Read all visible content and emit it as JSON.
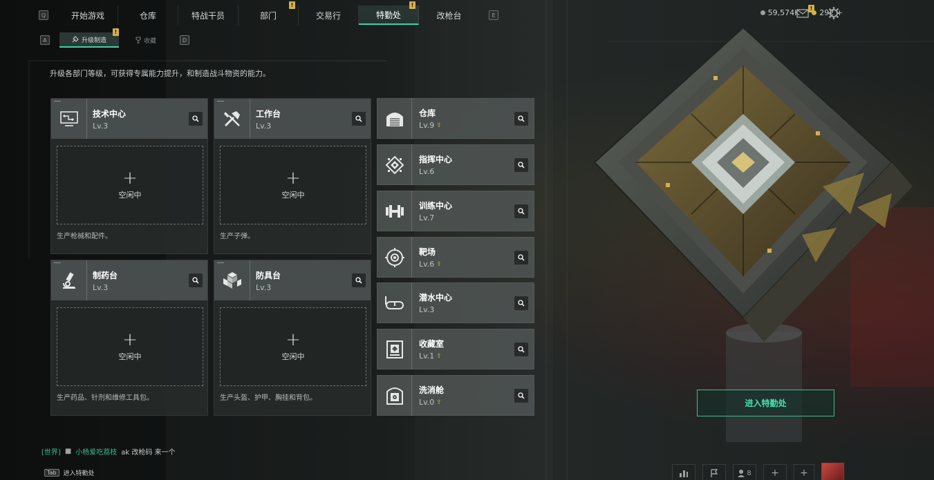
{
  "nav": {
    "left_key": "Q",
    "right_key": "E",
    "tabs": [
      {
        "label": "开始游戏",
        "badge": ""
      },
      {
        "label": "仓库",
        "badge": ""
      },
      {
        "label": "特战干员",
        "badge": ""
      },
      {
        "label": "部门",
        "badge": "!"
      },
      {
        "label": "交易行",
        "badge": ""
      },
      {
        "label": "特勤处",
        "badge": "!",
        "active": true
      },
      {
        "label": "改枪台",
        "badge": ""
      }
    ]
  },
  "subnav": {
    "left_key": "A",
    "right_key": "D",
    "tabs": [
      {
        "label": "升级制造",
        "badge": "!",
        "active": true
      },
      {
        "label": "收藏"
      }
    ]
  },
  "resources": {
    "coins": "59,574K",
    "tokens": "292 +",
    "mail_badge": "!"
  },
  "description": "升级各部门等级，可获得专属能力提升，和制造战斗物资的能力。",
  "production": [
    {
      "name": "技术中心",
      "level": "Lv.3",
      "status": "空闲中",
      "note": "生产枪械和配件。",
      "icon": "tech-center-icon"
    },
    {
      "name": "工作台",
      "level": "Lv.3",
      "status": "空闲中",
      "note": "生产子弹。",
      "icon": "workbench-icon"
    },
    {
      "name": "制药台",
      "level": "Lv.3",
      "status": "空闲中",
      "note": "生产药品、针剂和维修工具包。",
      "icon": "microscope-icon"
    },
    {
      "name": "防具台",
      "level": "Lv.3",
      "status": "空闲中",
      "note": "生产头盔、护甲、胸挂和背包。",
      "icon": "armor-bench-icon"
    }
  ],
  "departments": [
    {
      "name": "仓库",
      "level": "Lv.9",
      "upgrade": true,
      "icon": "warehouse-icon"
    },
    {
      "name": "指挥中心",
      "level": "Lv.6",
      "upgrade": false,
      "icon": "command-center-icon"
    },
    {
      "name": "训练中心",
      "level": "Lv.7",
      "upgrade": false,
      "icon": "dumbbell-icon"
    },
    {
      "name": "靶场",
      "level": "Lv.6",
      "upgrade": true,
      "icon": "target-icon"
    },
    {
      "name": "潜水中心",
      "level": "Lv.3",
      "upgrade": false,
      "icon": "diving-mask-icon"
    },
    {
      "name": "收藏室",
      "level": "Lv.1",
      "upgrade": true,
      "icon": "collection-room-icon"
    },
    {
      "name": "洗消舱",
      "level": "Lv.0",
      "upgrade": true,
      "icon": "decontamination-icon"
    }
  ],
  "enter_button": "进入特勤处",
  "chat": {
    "channel": "[世界]",
    "user": "小杨爱吃荔枝",
    "message": "ak 改枪码 来一个"
  },
  "tab_hint": {
    "key": "Tab",
    "label": "进入特勤处"
  },
  "bottom_bar": {
    "friends_count": "8"
  },
  "colors": {
    "accent": "#3fd2a4",
    "badge": "#d4b04c",
    "card": "#4e5453"
  }
}
